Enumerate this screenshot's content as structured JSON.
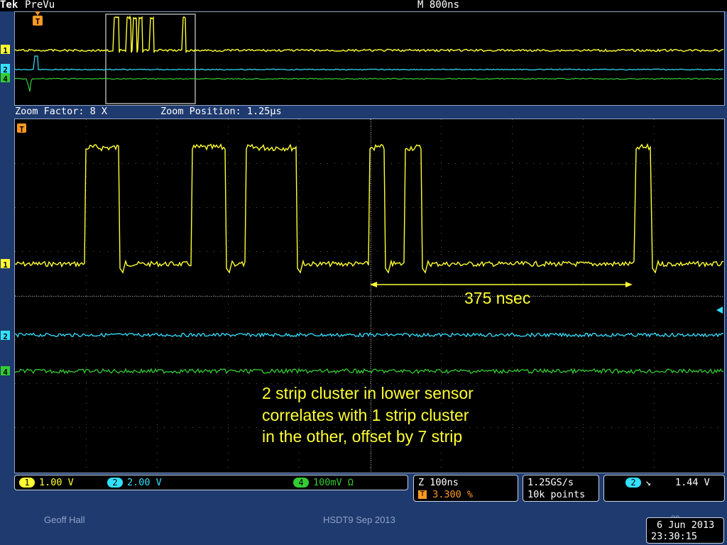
{
  "header": {
    "brand": "Tek",
    "mode": "PreVu",
    "timebase": "M 800ns"
  },
  "zoom": {
    "factor_label": "Zoom Factor: 8 X",
    "position_label": "Zoom Position: 1.25µs"
  },
  "channels": [
    {
      "id": "1",
      "color": "#ffff33"
    },
    {
      "id": "2",
      "color": "#33e0ff"
    },
    {
      "id": "4",
      "color": "#33cc33"
    }
  ],
  "markers": {
    "trigger": "T"
  },
  "annotations": {
    "interval": "375 nsec",
    "note_lines": [
      "2 strip cluster in lower sensor",
      "correlates with 1 strip cluster",
      "in the other, offset by 7 strip"
    ]
  },
  "status": {
    "ch1_scale": "1.00 V",
    "ch2_scale": "2.00 V",
    "ch4_scale": "100mV Ω",
    "zoom_scale": "Z 100ns",
    "trigger_pos": "3.300 %",
    "sample_rate": "1.25GS/s",
    "record_length": "10k points",
    "trigger_source": "2",
    "trigger_slope": "↘",
    "trigger_level": "1.44 V"
  },
  "footer": {
    "author": "Geoff Hall",
    "event": "HSDT9 Sep 2013",
    "slide_number": "20",
    "date": "6 Jun 2013",
    "time": "23:30:15"
  }
}
